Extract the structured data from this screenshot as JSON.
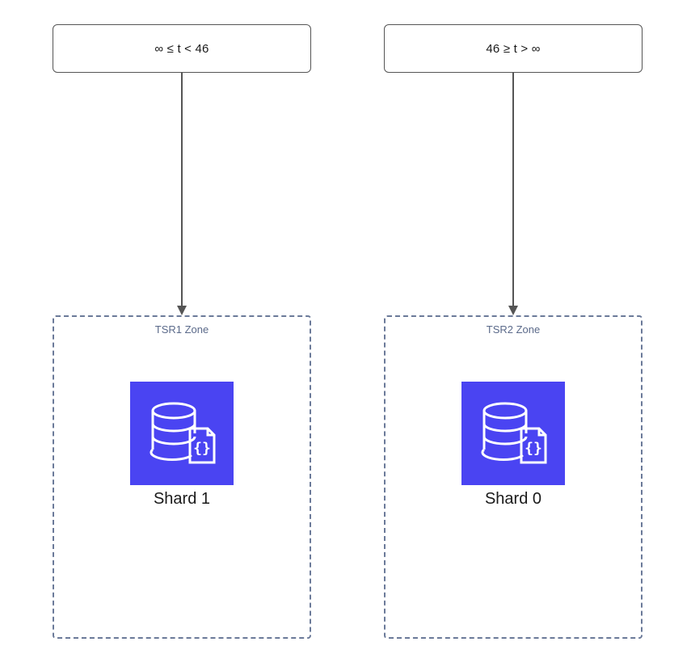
{
  "left": {
    "condition": "∞ ≤ t < 46",
    "zone_title": "TSR1 Zone",
    "shard_label": "Shard 1"
  },
  "right": {
    "condition": "46 ≥ t > ∞",
    "zone_title": "TSR2 Zone",
    "shard_label": "Shard 0"
  },
  "icons": {
    "db_json": "database-json-icon"
  }
}
